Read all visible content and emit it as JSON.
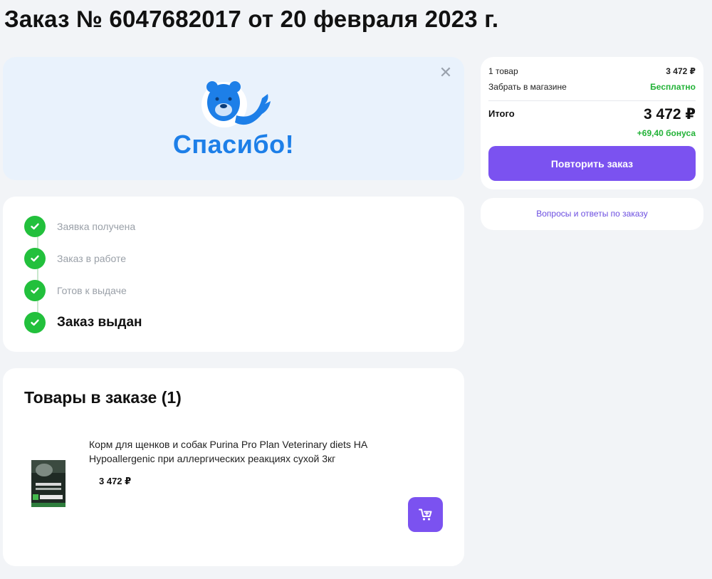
{
  "page_title": "Заказ № 6047682017 от 20 февраля 2023 г.",
  "thanks": {
    "text": "Спасибо!",
    "close_icon": "close-icon",
    "mascot_icon": "bear-mascot-icon"
  },
  "status": {
    "steps": [
      {
        "label": "Заявка получена",
        "done": true
      },
      {
        "label": "Заказ в работе",
        "done": true
      },
      {
        "label": "Готов к выдаче",
        "done": true
      },
      {
        "label": "Заказ выдан",
        "done": true
      }
    ]
  },
  "items": {
    "title": "Товары в заказе (1)",
    "products": [
      {
        "name": "Корм для щенков и собак Purina Pro Plan Veterinary diets HA Hypoallergenic при аллергических реакциях сухой 3кг",
        "price": "3 472 ₽"
      }
    ],
    "cart_icon": "cart-icon"
  },
  "summary": {
    "items_count_label": "1 товар",
    "items_total": "3 472 ₽",
    "delivery_label": "Забрать в магазине",
    "delivery_value": "Бесплатно",
    "total_label": "Итого",
    "total_value": "3 472 ₽",
    "bonus": "+69,40 бонуса",
    "repeat_button": "Повторить заказ"
  },
  "faq": {
    "link": "Вопросы и ответы по заказу"
  },
  "colors": {
    "accent": "#7b52f0",
    "success": "#22c03c",
    "brand_blue": "#1d7fe8"
  }
}
